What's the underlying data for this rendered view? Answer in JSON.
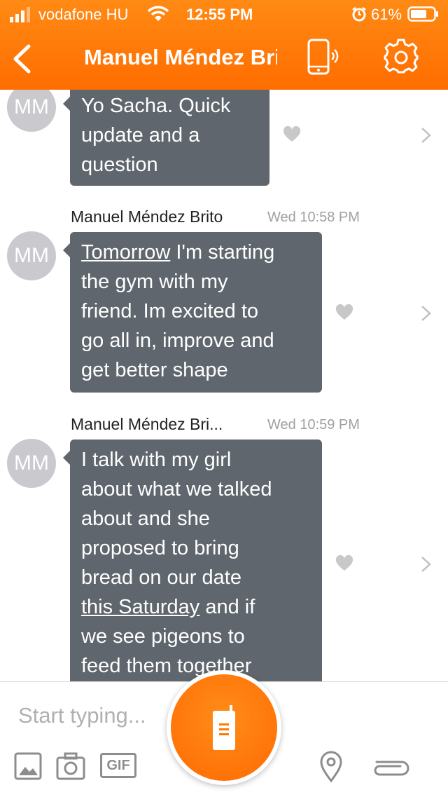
{
  "status": {
    "carrier": "vodafone HU",
    "time": "12:55 PM",
    "battery": "61%"
  },
  "header": {
    "title": "Manuel Méndez Brito",
    "back_icon": "chevron-left-icon",
    "phone_icon": "phone-vibrate-icon",
    "settings_icon": "gear-icon"
  },
  "messages": [
    {
      "initials": "MM",
      "sender": "",
      "time": "",
      "text_parts": [
        {
          "text": "Yo Sacha. Quick",
          "u": false
        },
        {
          "text": "update and a",
          "u": false
        },
        {
          "text": "question",
          "u": false
        }
      ]
    },
    {
      "initials": "MM",
      "sender": "Manuel Méndez Brito",
      "time": "Wed 10:58 PM",
      "lines": [
        [
          {
            "text": "Tomorrow",
            "u": true
          },
          {
            "text": " I'm starting",
            "u": false
          }
        ],
        [
          {
            "text": "the gym with my",
            "u": false
          }
        ],
        [
          {
            "text": "friend. Im excited to",
            "u": false
          }
        ],
        [
          {
            "text": "go all in, improve and",
            "u": false
          }
        ],
        [
          {
            "text": "get better shape",
            "u": false
          }
        ]
      ]
    },
    {
      "initials": "MM",
      "sender": "Manuel Méndez Bri...",
      "time": "Wed 10:59 PM",
      "lines": [
        [
          {
            "text": "I talk with my girl",
            "u": false
          }
        ],
        [
          {
            "text": "about what we talked",
            "u": false
          }
        ],
        [
          {
            "text": "about and she",
            "u": false
          }
        ],
        [
          {
            "text": "proposed to bring",
            "u": false
          }
        ],
        [
          {
            "text": "bread on our date",
            "u": false
          }
        ],
        [
          {
            "text": "this Saturday",
            "u": true
          },
          {
            "text": " and if",
            "u": false
          }
        ],
        [
          {
            "text": "we see pigeons to",
            "u": false
          }
        ],
        [
          {
            "text": "feed them together",
            "u": false
          }
        ]
      ]
    }
  ],
  "composer": {
    "placeholder": "Start typing...",
    "gif_label": "GIF",
    "icons": [
      "image-icon",
      "camera-icon",
      "gif-icon",
      "walkie-talkie-icon",
      "location-pin-icon",
      "paperclip-icon"
    ]
  },
  "colors": {
    "accent": "#ff6d00",
    "bubble": "#5f666d",
    "avatar": "#c9c9ce"
  }
}
